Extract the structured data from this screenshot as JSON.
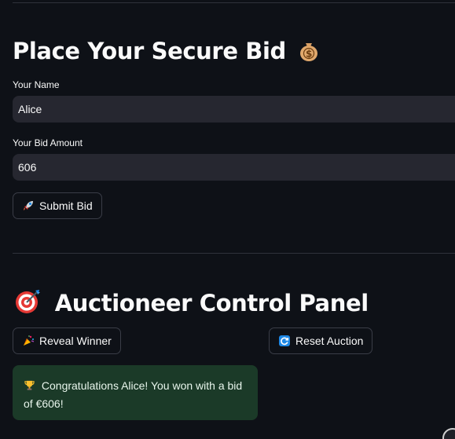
{
  "bid_section": {
    "title": "Place Your Secure Bid",
    "title_icon": "money-bag-icon",
    "name_label": "Your Name",
    "name_value": "Alice",
    "amount_label": "Your Bid Amount",
    "amount_value": "606",
    "submit_label": "Submit Bid",
    "submit_icon": "rocket-icon"
  },
  "control_panel": {
    "title": "Auctioneer Control Panel",
    "title_icon": "target-icon",
    "reveal_label": "Reveal Winner",
    "reveal_icon": "party-popper-icon",
    "reset_label": "Reset Auction",
    "reset_icon": "refresh-icon",
    "result_message": "Congratulations Alice! You won with a bid of €606!",
    "result_icon": "trophy-icon"
  },
  "colors": {
    "background": "#0e1117",
    "input_bg": "#262730",
    "success_bg": "#1b3a28",
    "accent_blue": "#1e88e5"
  }
}
